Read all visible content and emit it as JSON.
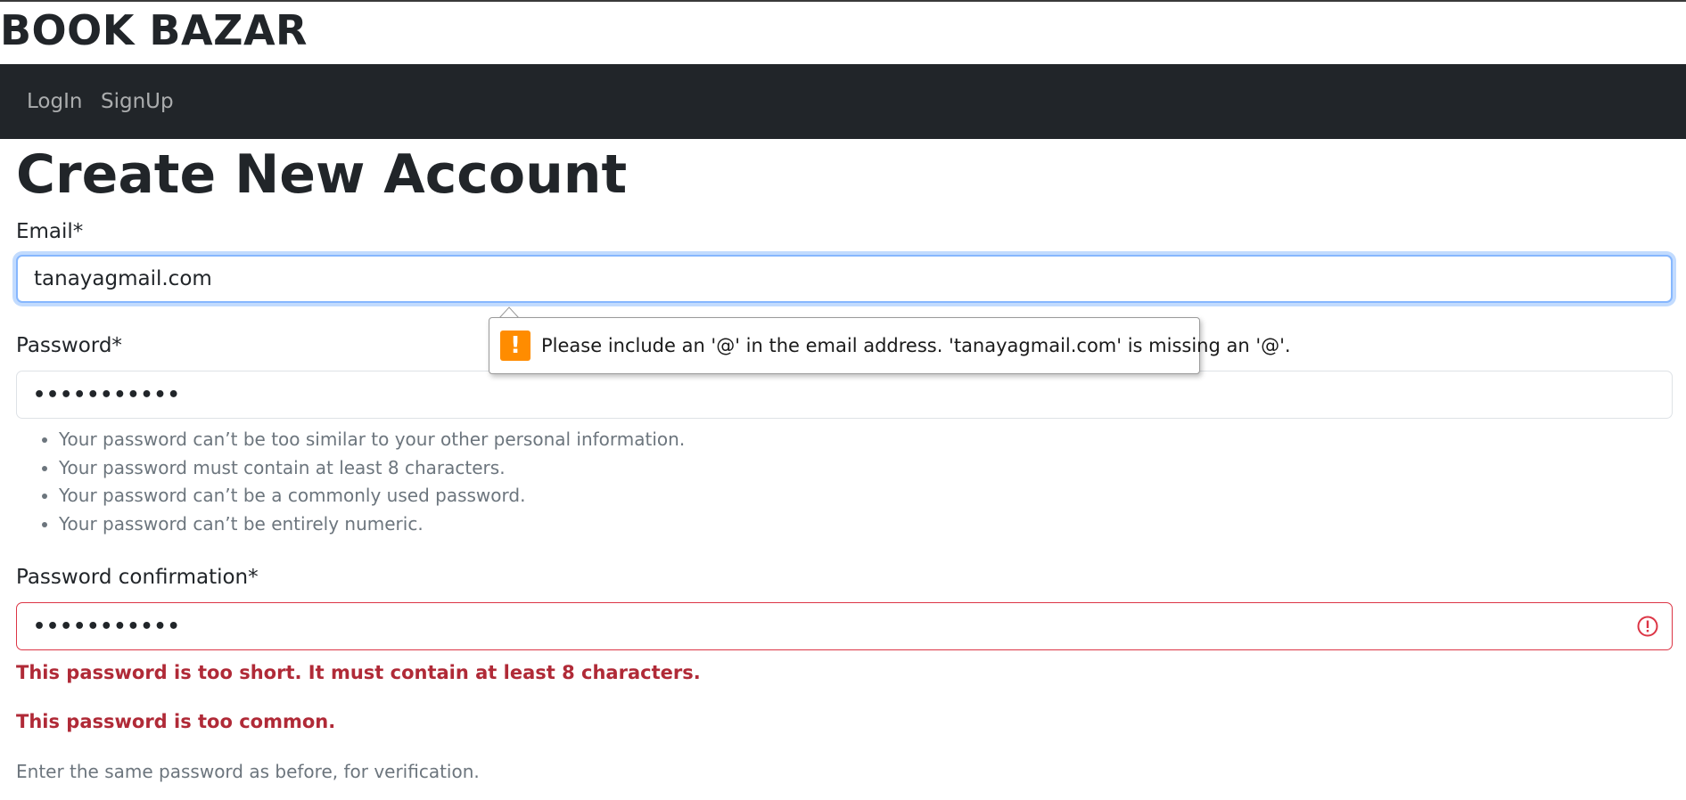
{
  "brand": "BOOK BAZAR",
  "nav": {
    "login": "LogIn",
    "signup": "SignUp"
  },
  "page_title": "Create New Account",
  "form": {
    "email": {
      "label": "Email*",
      "value": "tanayagmail.com"
    },
    "password": {
      "label": "Password*",
      "value": "•••••••••••",
      "help": [
        "Your password can’t be too similar to your other personal information.",
        "Your password must contain at least 8 characters.",
        "Your password can’t be a commonly used password.",
        "Your password can’t be entirely numeric."
      ]
    },
    "password_confirmation": {
      "label": "Password confirmation*",
      "value": "•••••••••••",
      "errors": [
        "This password is too short. It must contain at least 8 characters.",
        "This password is too common."
      ],
      "help": "Enter the same password as before, for verification."
    }
  },
  "validation_tooltip": {
    "icon": "warning-icon",
    "message": "Please include an '@' in the email address. 'tanayagmail.com' is missing an '@'."
  },
  "colors": {
    "navbar_bg": "#212529",
    "focus_border": "#86b7fe",
    "error": "#b02a37",
    "invalid_border": "#dc3545",
    "warning_icon": "#ff8c00",
    "muted_text": "#6c757d"
  }
}
